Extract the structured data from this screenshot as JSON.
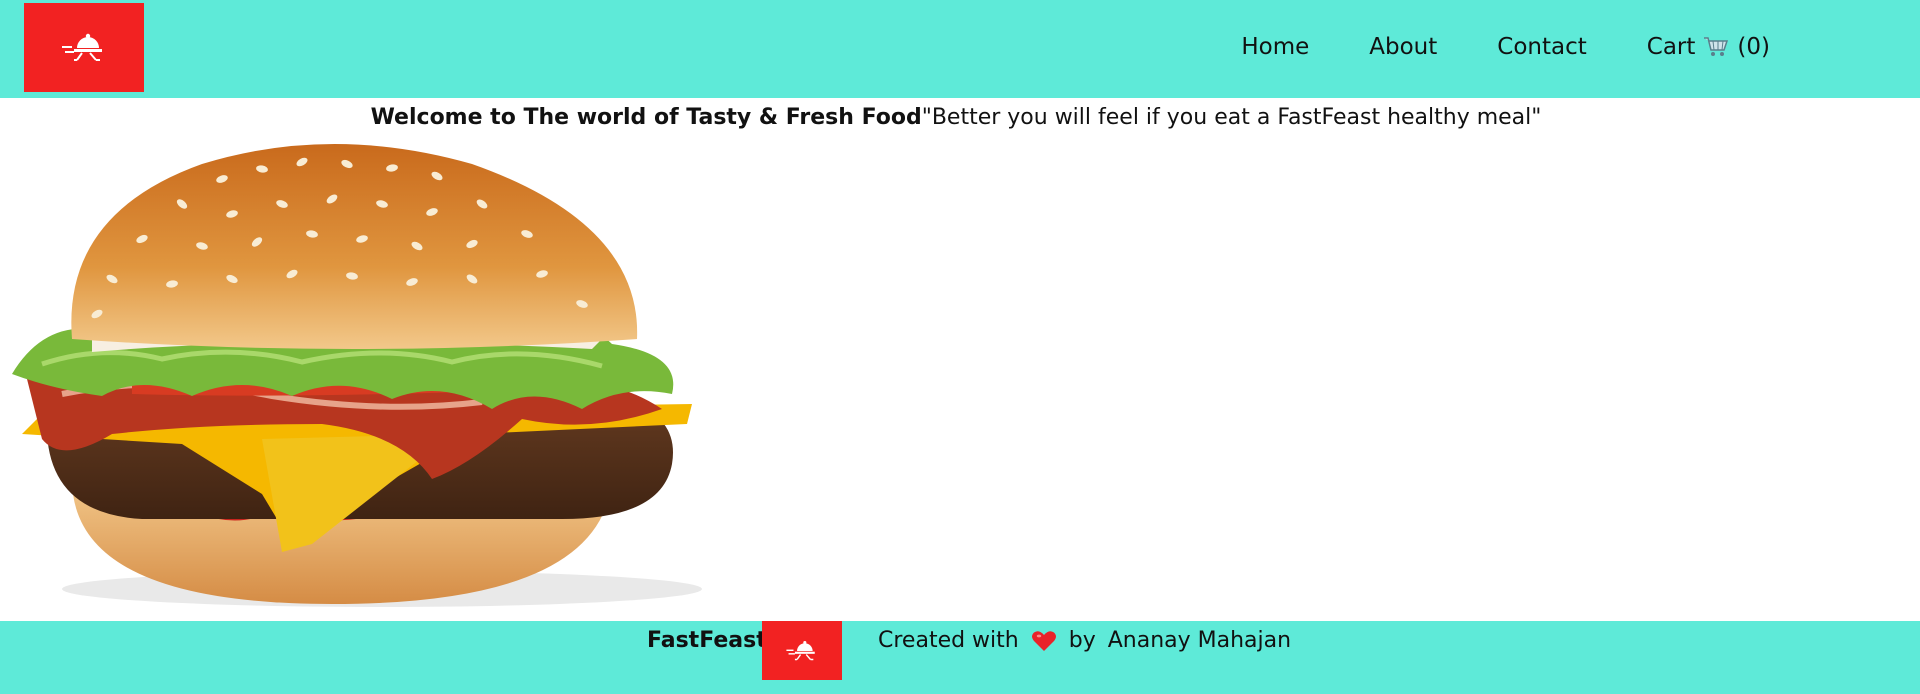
{
  "header": {
    "logo_icon": "food-delivery-cloche-icon",
    "nav": {
      "home": "Home",
      "about": "About",
      "contact": "Contact",
      "cart_label": "Cart",
      "cart_icon": "shopping-cart-icon",
      "cart_count": "(0)"
    }
  },
  "main": {
    "welcome_bold": "Welcome to The world of Tasty & Fresh Food",
    "welcome_quote": "\"Better you will feel if you eat a FastFeast healthy meal\"",
    "hero_image": "burger-image"
  },
  "footer": {
    "brand": "FastFeast",
    "logo_icon": "food-delivery-cloche-icon",
    "created_with": "Created with",
    "heart_icon": "heart-icon",
    "by": "by",
    "author": "Ananay Mahajan"
  },
  "colors": {
    "header_bg": "#5eead8",
    "logo_bg": "#f22222",
    "text": "#111111"
  }
}
